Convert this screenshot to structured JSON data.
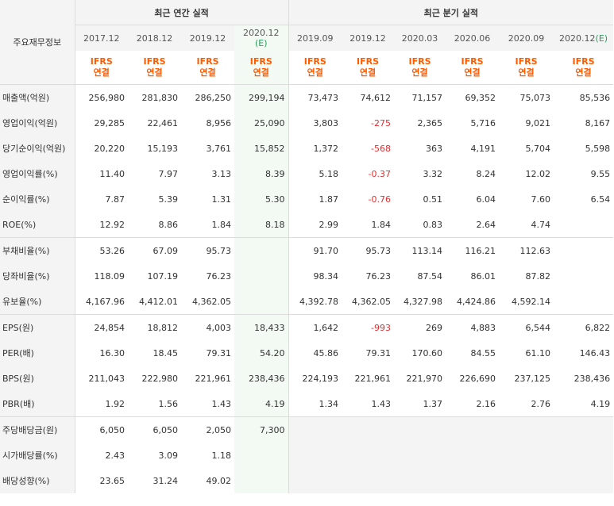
{
  "corner_label": "주요재무정보",
  "annual_header": "최근 연간 실적",
  "quarter_header": "최근 분기 실적",
  "annual_periods": [
    {
      "label": "2017.12",
      "est": ""
    },
    {
      "label": "2018.12",
      "est": ""
    },
    {
      "label": "2019.12",
      "est": ""
    },
    {
      "label": "2020.12",
      "est": "(E)"
    }
  ],
  "quarter_periods": [
    {
      "label": "2019.09",
      "est": ""
    },
    {
      "label": "2019.12",
      "est": ""
    },
    {
      "label": "2020.03",
      "est": ""
    },
    {
      "label": "2020.06",
      "est": ""
    },
    {
      "label": "2020.09",
      "est": ""
    },
    {
      "label": "2020.12",
      "est": "(E)"
    }
  ],
  "ifrs_top": "IFRS",
  "ifrs_bottom": "연결",
  "rows": [
    {
      "label": "매출액(억원)",
      "values": [
        "256,980",
        "281,830",
        "286,250",
        "299,194",
        "73,473",
        "74,612",
        "71,157",
        "69,352",
        "75,073",
        "85,536"
      ]
    },
    {
      "label": "영업이익(억원)",
      "values": [
        "29,285",
        "22,461",
        "8,956",
        "25,090",
        "3,803",
        "-275",
        "2,365",
        "5,716",
        "9,021",
        "8,167"
      ]
    },
    {
      "label": "당기순이익(억원)",
      "values": [
        "20,220",
        "15,193",
        "3,761",
        "15,852",
        "1,372",
        "-568",
        "363",
        "4,191",
        "5,704",
        "5,598"
      ]
    },
    {
      "label": "영업이익률(%)",
      "values": [
        "11.40",
        "7.97",
        "3.13",
        "8.39",
        "5.18",
        "-0.37",
        "3.32",
        "8.24",
        "12.02",
        "9.55"
      ]
    },
    {
      "label": "순이익률(%)",
      "values": [
        "7.87",
        "5.39",
        "1.31",
        "5.30",
        "1.87",
        "-0.76",
        "0.51",
        "6.04",
        "7.60",
        "6.54"
      ]
    },
    {
      "label": "ROE(%)",
      "values": [
        "12.92",
        "8.86",
        "1.84",
        "8.18",
        "2.99",
        "1.84",
        "0.83",
        "2.64",
        "4.74",
        ""
      ]
    },
    {
      "label": "부채비율(%)",
      "values": [
        "53.26",
        "67.09",
        "95.73",
        "",
        "91.70",
        "95.73",
        "113.14",
        "116.21",
        "112.63",
        ""
      ]
    },
    {
      "label": "당좌비율(%)",
      "values": [
        "118.09",
        "107.19",
        "76.23",
        "",
        "98.34",
        "76.23",
        "87.54",
        "86.01",
        "87.82",
        ""
      ]
    },
    {
      "label": "유보율(%)",
      "values": [
        "4,167.96",
        "4,412.01",
        "4,362.05",
        "",
        "4,392.78",
        "4,362.05",
        "4,327.98",
        "4,424.86",
        "4,592.14",
        ""
      ]
    },
    {
      "label": "EPS(원)",
      "values": [
        "24,854",
        "18,812",
        "4,003",
        "18,433",
        "1,642",
        "-993",
        "269",
        "4,883",
        "6,544",
        "6,822"
      ]
    },
    {
      "label": "PER(배)",
      "values": [
        "16.30",
        "18.45",
        "79.31",
        "54.20",
        "45.86",
        "79.31",
        "170.60",
        "84.55",
        "61.10",
        "146.43"
      ]
    },
    {
      "label": "BPS(원)",
      "values": [
        "211,043",
        "222,980",
        "221,961",
        "238,436",
        "224,193",
        "221,961",
        "221,970",
        "226,690",
        "237,125",
        "238,436"
      ]
    },
    {
      "label": "PBR(배)",
      "values": [
        "1.92",
        "1.56",
        "1.43",
        "4.19",
        "1.34",
        "1.43",
        "1.37",
        "2.16",
        "2.76",
        "4.19"
      ]
    },
    {
      "label": "주당배당금(원)",
      "values": [
        "6,050",
        "6,050",
        "2,050",
        "7,300"
      ]
    },
    {
      "label": "시가배당률(%)",
      "values": [
        "2.43",
        "3.09",
        "1.18",
        ""
      ]
    },
    {
      "label": "배당성향(%)",
      "values": [
        "23.65",
        "31.24",
        "49.02",
        ""
      ]
    }
  ],
  "group_end_rows": [
    5,
    8,
    12
  ],
  "colors": {
    "negative": "#e03030",
    "ifrs": "#ff5c00",
    "estimate_mark": "#25a05a",
    "estimate_bg": "#f3faf3"
  }
}
